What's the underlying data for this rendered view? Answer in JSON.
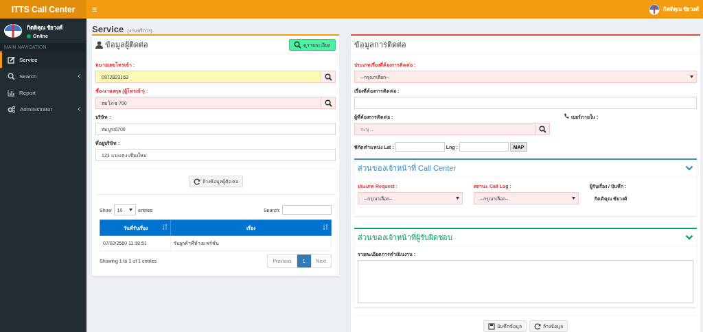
{
  "header": {
    "brand": "ITTS Call Center",
    "menu_icon": "≡",
    "user_name": "กิตติคุณ ชัยวงศ์"
  },
  "sidebar": {
    "user": {
      "name": "กิตติคุณ ชัยวงศ์",
      "status": "Online"
    },
    "nav_header": "MAIN NAVIGATION",
    "items": [
      {
        "kind": "edit",
        "label": "Service",
        "selected": true,
        "has_submenu": false
      },
      {
        "kind": "search",
        "label": "Search",
        "selected": false,
        "has_submenu": true
      },
      {
        "kind": "chart",
        "label": "Report",
        "selected": false,
        "has_submenu": false
      },
      {
        "kind": "gears",
        "label": "Administrator",
        "selected": false,
        "has_submenu": true
      }
    ]
  },
  "page": {
    "title": "Service",
    "subtitle": "(งานบริการ)"
  },
  "contact_panel": {
    "title": "ข้อมูลผู้ติดต่อ",
    "detail_button": "ดูรายละเอียด",
    "fields": [
      {
        "label": "หมายเลขโทรเข้า :",
        "required": true,
        "value": "0972823163",
        "kind": "warning",
        "search": true
      },
      {
        "label": "ชื่อ-นามสกุล (ผู้โทรเข้า) :",
        "required": true,
        "value": "สมโภช 700",
        "kind": "error",
        "search": true
      },
      {
        "label": "บริษัท :",
        "required": false,
        "value": "สมบูรณ์700",
        "kind": "plain",
        "search": false
      },
      {
        "label": "ที่อยู่บริษัท :",
        "required": false,
        "value": "123 แม่แตง เชียงใหม่",
        "kind": "plain",
        "search": false
      }
    ],
    "clear_button": "ล้างข้อมูลผู้ติดต่อ",
    "table": {
      "show_label": "Show",
      "page_size": "10",
      "entries_label": "entries",
      "search_label": "Search:",
      "columns": [
        {
          "label": "วันที่รับเรื่อง"
        },
        {
          "label": "เรื่อง"
        }
      ],
      "rows": [
        [
          "07/02/2560 11:18:51",
          "รับลูกค้าที่ห้างแฟร์ชั่น"
        ]
      ],
      "info": "Showing 1 to 1 of 1 entries",
      "pagination": [
        {
          "label": "Previous",
          "selected": false
        },
        {
          "label": "1",
          "selected": true
        },
        {
          "label": "Next",
          "selected": false
        }
      ]
    }
  },
  "contact_info": {
    "title": "ข้อมูลการติดต่อ",
    "type_field": {
      "label": "ประเภทเรื่องที่ต้องการติดต่อ :",
      "value": "--กรุณาเลือก--"
    },
    "subject_label": "เรื่องที่ต้องการติดต่อ :",
    "person": {
      "label": "ผู้ที่ต้องการติดต่อ :",
      "placeholder": "ระบุ ..."
    },
    "extension_label": "เบอร์ภายใน :",
    "lat_label": "พิกัดตำแหน่ง Lat :",
    "lng_label": "Lng :",
    "map_button": "MAP"
  },
  "call_center_section": {
    "title": "ส่วนของเจ้าหน้าที่ Call Center",
    "request_type": {
      "label": "ประเภท Request :",
      "value": "--กรุณาเลือก--"
    },
    "call_log": {
      "label": "สถานะ Call Log :",
      "value": "--กรุณาเลือก--"
    },
    "recorder": {
      "label": "ผู้รับเรื่อง / บันทึก :",
      "value": "กิตติคุณ ชัยวงศ์"
    }
  },
  "responsible_section": {
    "title": "ส่วนของเจ้าหน้าที่ผู้รับผิดชอบ",
    "details_label": "รายละเอียดการดำเนินงาน :"
  },
  "buttons": [
    {
      "kind": "save",
      "label": "บันทึกข้อมูล"
    },
    {
      "kind": "refresh",
      "label": "ล้างข้อมูล"
    }
  ]
}
